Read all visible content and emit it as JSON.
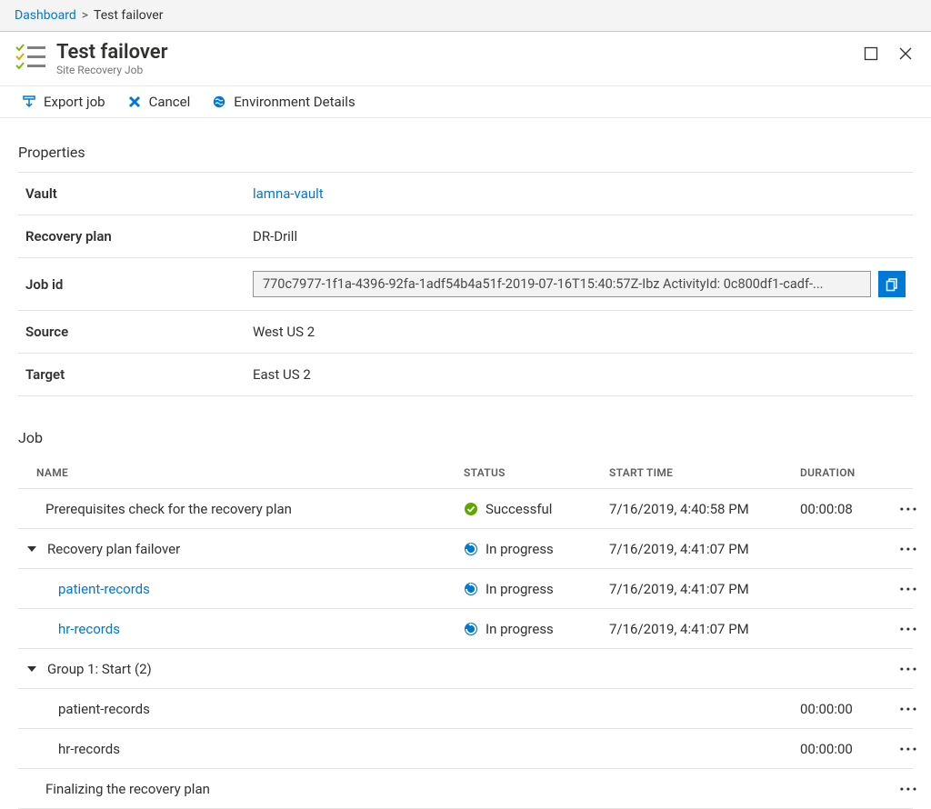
{
  "breadcrumb": {
    "root": "Dashboard",
    "current": "Test failover"
  },
  "header": {
    "title": "Test failover",
    "subtitle": "Site Recovery Job"
  },
  "commands": {
    "export": "Export job",
    "cancel": "Cancel",
    "env": "Environment Details"
  },
  "sections": {
    "properties": "Properties",
    "job": "Job"
  },
  "properties": {
    "vault_label": "Vault",
    "vault_value": "lamna-vault",
    "plan_label": "Recovery plan",
    "plan_value": "DR-Drill",
    "jobid_label": "Job id",
    "jobid_value": "770c7977-1f1a-4396-92fa-1adf54b4a51f-2019-07-16T15:40:57Z-Ibz ActivityId: 0c800df1-cadf-...",
    "source_label": "Source",
    "source_value": "West US 2",
    "target_label": "Target",
    "target_value": "East US 2"
  },
  "job_columns": {
    "name": "NAME",
    "status": "STATUS",
    "start": "START TIME",
    "duration": "DURATION"
  },
  "jobs": {
    "r0": {
      "name": "Prerequisites check for the recovery plan",
      "status": "Successful",
      "start": "7/16/2019, 4:40:58 PM",
      "duration": "00:00:08"
    },
    "r1": {
      "name": "Recovery plan failover",
      "status": "In progress",
      "start": "7/16/2019, 4:41:07 PM",
      "duration": ""
    },
    "r2": {
      "name": "patient-records",
      "status": "In progress",
      "start": "7/16/2019, 4:41:07 PM",
      "duration": ""
    },
    "r3": {
      "name": "hr-records",
      "status": "In progress",
      "start": "7/16/2019, 4:41:07 PM",
      "duration": ""
    },
    "r4": {
      "name": "Group 1: Start (2)",
      "status": "",
      "start": "",
      "duration": ""
    },
    "r5": {
      "name": "patient-records",
      "status": "",
      "start": "",
      "duration": "00:00:00"
    },
    "r6": {
      "name": "hr-records",
      "status": "",
      "start": "",
      "duration": "00:00:00"
    },
    "r7": {
      "name": "Finalizing the recovery plan",
      "status": "",
      "start": "",
      "duration": ""
    }
  }
}
